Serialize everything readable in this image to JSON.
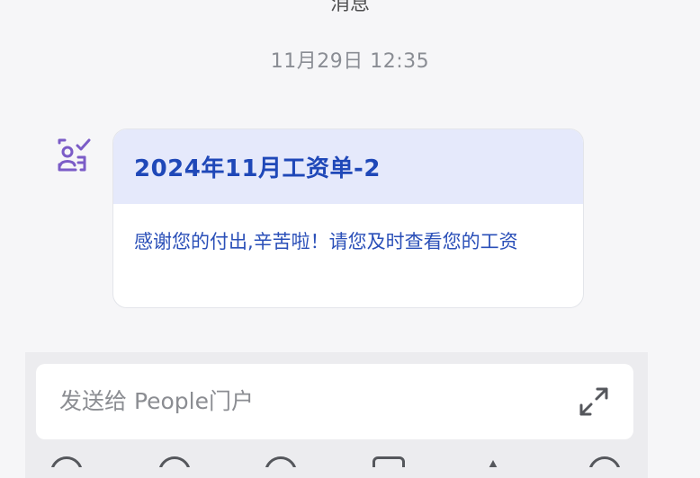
{
  "header": {
    "title": "消息"
  },
  "timestamp": "11月29日 12:35",
  "message": {
    "icon": "person-checklist-icon",
    "title": "2024年11月工资单-2",
    "body": "感谢您的付出,辛苦啦！请您及时查看您的工资"
  },
  "composer": {
    "placeholder": "发送给 People门户",
    "expand_icon": "expand-arrows-icon"
  },
  "toolbar": {
    "icons": [
      "voice-icon",
      "emoji-icon",
      "location-icon",
      "image-icon",
      "font-icon",
      "add-icon"
    ]
  },
  "colors": {
    "accent": "#1f48b8",
    "icon_purple": "#7b5cc7",
    "card_header_bg": "#e5e9fb"
  }
}
